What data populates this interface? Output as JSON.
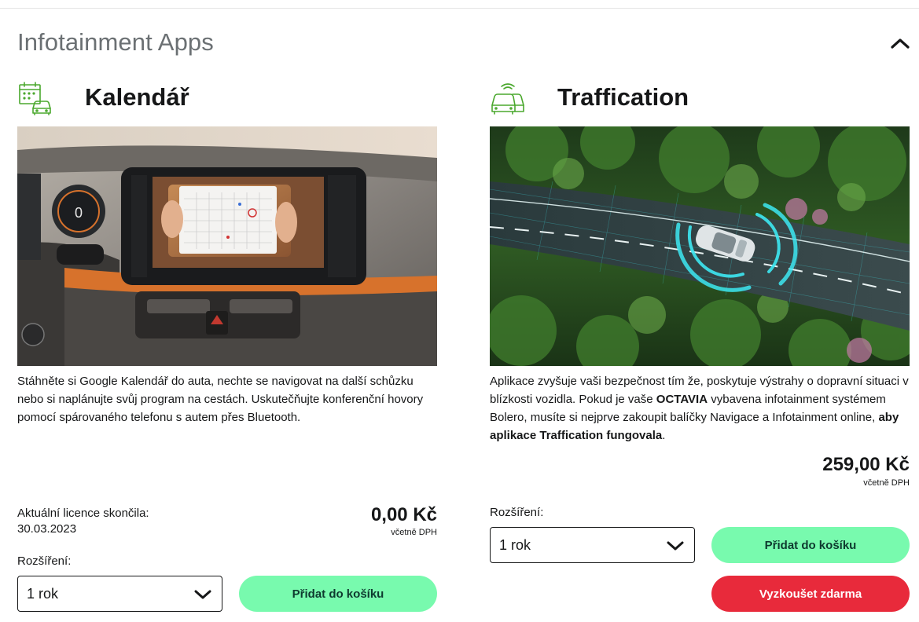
{
  "section": {
    "title": "Infotainment Apps"
  },
  "colors": {
    "accent_green": "#78faae",
    "accent_red": "#e82a3b",
    "icon_green": "#4ba82e",
    "title_gray": "#6b7073"
  },
  "cards": [
    {
      "icon": "calendar-car-icon",
      "title": "Kalendář",
      "description": "Stáhněte si Google Kalendář do auta, nechte se navigovat na další schůzku nebo si naplánujte svůj program na cestách. Uskutečňujte konferenční hovory pomocí spárovaného telefonu s autem přes Bluetooth.",
      "license_label": "Aktuální licence skončila:",
      "license_date": "30.03.2023",
      "price": "0,00 Kč",
      "price_note": "včetně DPH",
      "extension_label": "Rozšíření:",
      "select_value": "1 rok",
      "add_to_cart": "Přidat do košíku"
    },
    {
      "icon": "connected-car-icon",
      "title": "Traffication",
      "description_parts": {
        "p1": "Aplikace zvyšuje vaši bezpečnost tím že, poskytuje výstrahy o dopravní situaci v blízkosti vozidla. Pokud je vaše ",
        "bold1": "OCTAVIA",
        "p2": " vybavena infotainment systémem Bolero, musíte si nejprve zakoupit balíčky Navigace a Infotainment online, ",
        "bold2": "aby aplikace Traffication fungovala",
        "p3": "."
      },
      "price": "259,00 Kč",
      "price_note": "včetně DPH",
      "extension_label": "Rozšíření:",
      "select_value": "1 rok",
      "add_to_cart": "Přidat do košíku",
      "try_free": "Vyzkoušet zdarma"
    }
  ]
}
